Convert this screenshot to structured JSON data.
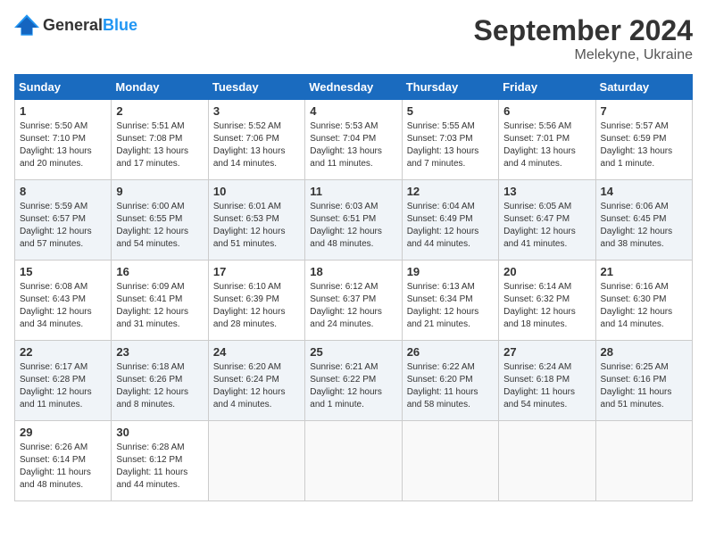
{
  "header": {
    "logo": {
      "general": "General",
      "blue": "Blue"
    },
    "title": "September 2024",
    "location": "Melekyne, Ukraine"
  },
  "weekdays": [
    "Sunday",
    "Monday",
    "Tuesday",
    "Wednesday",
    "Thursday",
    "Friday",
    "Saturday"
  ],
  "weeks": [
    [
      {
        "day": "1",
        "info": "Sunrise: 5:50 AM\nSunset: 7:10 PM\nDaylight: 13 hours and 20 minutes."
      },
      {
        "day": "2",
        "info": "Sunrise: 5:51 AM\nSunset: 7:08 PM\nDaylight: 13 hours and 17 minutes."
      },
      {
        "day": "3",
        "info": "Sunrise: 5:52 AM\nSunset: 7:06 PM\nDaylight: 13 hours and 14 minutes."
      },
      {
        "day": "4",
        "info": "Sunrise: 5:53 AM\nSunset: 7:04 PM\nDaylight: 13 hours and 11 minutes."
      },
      {
        "day": "5",
        "info": "Sunrise: 5:55 AM\nSunset: 7:03 PM\nDaylight: 13 hours and 7 minutes."
      },
      {
        "day": "6",
        "info": "Sunrise: 5:56 AM\nSunset: 7:01 PM\nDaylight: 13 hours and 4 minutes."
      },
      {
        "day": "7",
        "info": "Sunrise: 5:57 AM\nSunset: 6:59 PM\nDaylight: 13 hours and 1 minute."
      }
    ],
    [
      {
        "day": "8",
        "info": "Sunrise: 5:59 AM\nSunset: 6:57 PM\nDaylight: 12 hours and 57 minutes."
      },
      {
        "day": "9",
        "info": "Sunrise: 6:00 AM\nSunset: 6:55 PM\nDaylight: 12 hours and 54 minutes."
      },
      {
        "day": "10",
        "info": "Sunrise: 6:01 AM\nSunset: 6:53 PM\nDaylight: 12 hours and 51 minutes."
      },
      {
        "day": "11",
        "info": "Sunrise: 6:03 AM\nSunset: 6:51 PM\nDaylight: 12 hours and 48 minutes."
      },
      {
        "day": "12",
        "info": "Sunrise: 6:04 AM\nSunset: 6:49 PM\nDaylight: 12 hours and 44 minutes."
      },
      {
        "day": "13",
        "info": "Sunrise: 6:05 AM\nSunset: 6:47 PM\nDaylight: 12 hours and 41 minutes."
      },
      {
        "day": "14",
        "info": "Sunrise: 6:06 AM\nSunset: 6:45 PM\nDaylight: 12 hours and 38 minutes."
      }
    ],
    [
      {
        "day": "15",
        "info": "Sunrise: 6:08 AM\nSunset: 6:43 PM\nDaylight: 12 hours and 34 minutes."
      },
      {
        "day": "16",
        "info": "Sunrise: 6:09 AM\nSunset: 6:41 PM\nDaylight: 12 hours and 31 minutes."
      },
      {
        "day": "17",
        "info": "Sunrise: 6:10 AM\nSunset: 6:39 PM\nDaylight: 12 hours and 28 minutes."
      },
      {
        "day": "18",
        "info": "Sunrise: 6:12 AM\nSunset: 6:37 PM\nDaylight: 12 hours and 24 minutes."
      },
      {
        "day": "19",
        "info": "Sunrise: 6:13 AM\nSunset: 6:34 PM\nDaylight: 12 hours and 21 minutes."
      },
      {
        "day": "20",
        "info": "Sunrise: 6:14 AM\nSunset: 6:32 PM\nDaylight: 12 hours and 18 minutes."
      },
      {
        "day": "21",
        "info": "Sunrise: 6:16 AM\nSunset: 6:30 PM\nDaylight: 12 hours and 14 minutes."
      }
    ],
    [
      {
        "day": "22",
        "info": "Sunrise: 6:17 AM\nSunset: 6:28 PM\nDaylight: 12 hours and 11 minutes."
      },
      {
        "day": "23",
        "info": "Sunrise: 6:18 AM\nSunset: 6:26 PM\nDaylight: 12 hours and 8 minutes."
      },
      {
        "day": "24",
        "info": "Sunrise: 6:20 AM\nSunset: 6:24 PM\nDaylight: 12 hours and 4 minutes."
      },
      {
        "day": "25",
        "info": "Sunrise: 6:21 AM\nSunset: 6:22 PM\nDaylight: 12 hours and 1 minute."
      },
      {
        "day": "26",
        "info": "Sunrise: 6:22 AM\nSunset: 6:20 PM\nDaylight: 11 hours and 58 minutes."
      },
      {
        "day": "27",
        "info": "Sunrise: 6:24 AM\nSunset: 6:18 PM\nDaylight: 11 hours and 54 minutes."
      },
      {
        "day": "28",
        "info": "Sunrise: 6:25 AM\nSunset: 6:16 PM\nDaylight: 11 hours and 51 minutes."
      }
    ],
    [
      {
        "day": "29",
        "info": "Sunrise: 6:26 AM\nSunset: 6:14 PM\nDaylight: 11 hours and 48 minutes."
      },
      {
        "day": "30",
        "info": "Sunrise: 6:28 AM\nSunset: 6:12 PM\nDaylight: 11 hours and 44 minutes."
      },
      {
        "day": "",
        "info": ""
      },
      {
        "day": "",
        "info": ""
      },
      {
        "day": "",
        "info": ""
      },
      {
        "day": "",
        "info": ""
      },
      {
        "day": "",
        "info": ""
      }
    ]
  ]
}
